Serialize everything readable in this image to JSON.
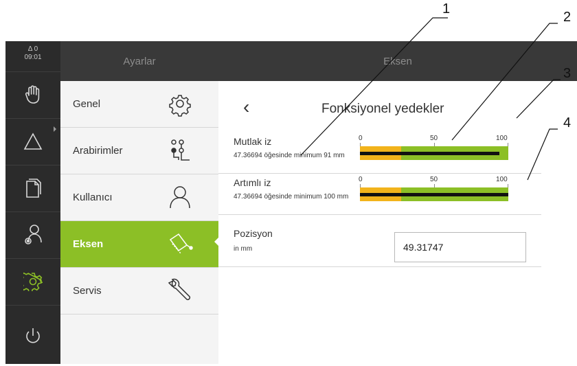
{
  "status": {
    "warning_count": "Δ 0",
    "time": "09:01"
  },
  "sidebar": {
    "items": [
      {
        "icon": "hand-icon"
      },
      {
        "icon": "triangle-icon"
      },
      {
        "icon": "document-icon"
      },
      {
        "icon": "user-settings-icon"
      },
      {
        "icon": "settings-icon"
      },
      {
        "icon": "power-icon"
      }
    ]
  },
  "header": {
    "left_title": "Ayarlar",
    "right_title": "Eksen"
  },
  "menu": {
    "items": [
      {
        "label": "Genel",
        "icon": "gear-icon"
      },
      {
        "label": "Arabirimler",
        "icon": "interface-icon"
      },
      {
        "label": "Kullanıcı",
        "icon": "user-icon"
      },
      {
        "label": "Eksen",
        "icon": "axis-icon",
        "active": true
      },
      {
        "label": "Servis",
        "icon": "wrench-icon"
      }
    ]
  },
  "panel": {
    "title": "Fonksiyonel yedekler",
    "rows": [
      {
        "label": "Mutlak iz",
        "sub": "47.36694 öğesinde minimum 91 mm",
        "ticks": [
          "0",
          "50",
          "100"
        ],
        "warn_fraction": 0.28,
        "line_fraction": 0.94
      },
      {
        "label": "Artımlı iz",
        "sub": "47.36694 öğesinde minimum 100 mm",
        "ticks": [
          "0",
          "50",
          "100"
        ],
        "warn_fraction": 0.28,
        "line_fraction": 1.0
      }
    ],
    "position": {
      "label": "Pozisyon",
      "unit": "in mm",
      "value": "49.31747"
    }
  },
  "callouts": [
    "1",
    "2",
    "3",
    "4"
  ],
  "colors": {
    "accent": "#8cbf26",
    "warning": "#f2b31b",
    "dark": "#2b2b2b"
  }
}
